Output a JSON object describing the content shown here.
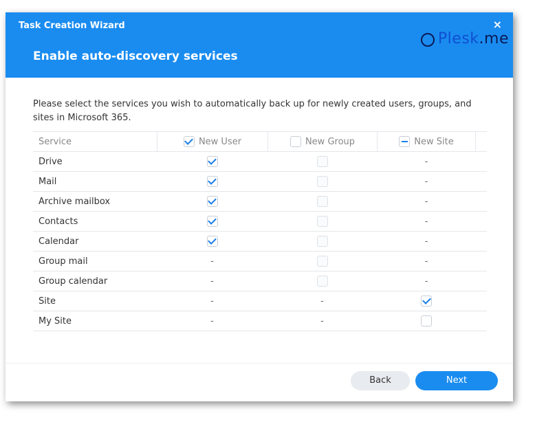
{
  "window": {
    "title": "Task Creation Wizard",
    "close_glyph": "×"
  },
  "watermark": {
    "main": "Plesk",
    "suffix": ".me"
  },
  "step": {
    "title": "Enable auto-discovery services",
    "description": "Please select the services you wish to automatically back up for newly created users, groups, and sites in Microsoft 365."
  },
  "table": {
    "headers": {
      "service": "Service",
      "new_user": {
        "label": "New User",
        "state": "checked"
      },
      "new_group": {
        "label": "New Group",
        "state": "unchecked"
      },
      "new_site": {
        "label": "New Site",
        "state": "partial"
      }
    },
    "rows": [
      {
        "service": "Drive",
        "user": "checked",
        "group": "disabled",
        "site": "-"
      },
      {
        "service": "Mail",
        "user": "checked",
        "group": "disabled",
        "site": "-"
      },
      {
        "service": "Archive mailbox",
        "user": "checked",
        "group": "disabled",
        "site": "-"
      },
      {
        "service": "Contacts",
        "user": "checked",
        "group": "disabled",
        "site": "-"
      },
      {
        "service": "Calendar",
        "user": "checked",
        "group": "disabled",
        "site": "-"
      },
      {
        "service": "Group mail",
        "user": "-",
        "group": "disabled",
        "site": "-"
      },
      {
        "service": "Group calendar",
        "user": "-",
        "group": "disabled",
        "site": "-"
      },
      {
        "service": "Site",
        "user": "-",
        "group": "-",
        "site": "checked"
      },
      {
        "service": "My Site",
        "user": "-",
        "group": "-",
        "site": "unchecked"
      }
    ]
  },
  "buttons": {
    "back": "Back",
    "next": "Next"
  },
  "colors": {
    "accent": "#1a8cf0",
    "check": "#1a7ee8"
  }
}
